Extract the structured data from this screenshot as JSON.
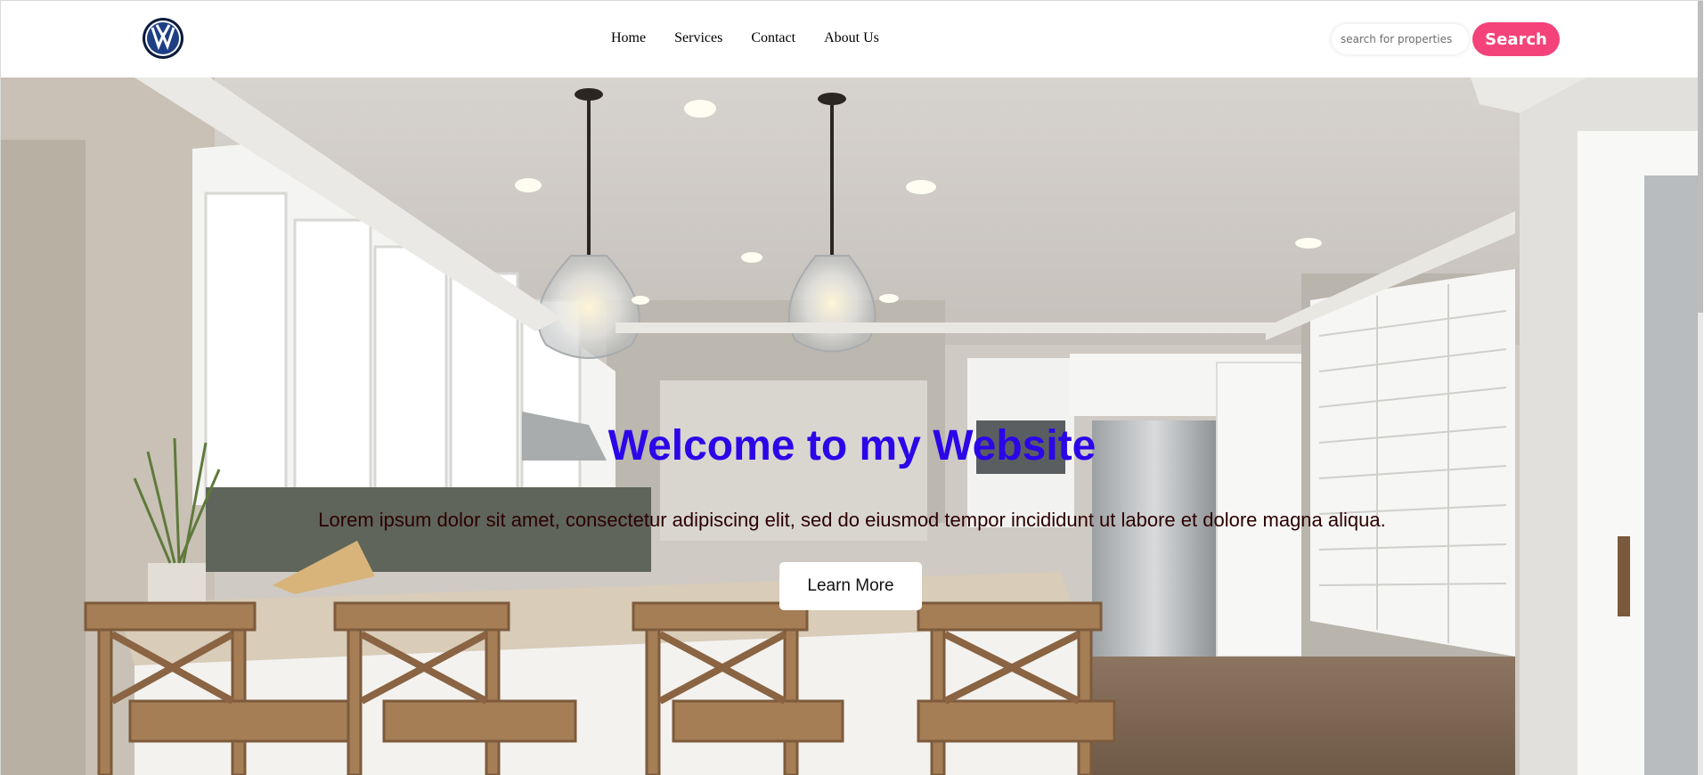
{
  "header": {
    "logo_icon": "volkswagen-logo-icon",
    "nav": [
      {
        "label": "Home"
      },
      {
        "label": "Services"
      },
      {
        "label": "Contact"
      },
      {
        "label": "About Us"
      }
    ],
    "search": {
      "placeholder": "search for properties",
      "value": "",
      "button_label": "Search"
    }
  },
  "hero": {
    "title": "Welcome to my Website",
    "subtitle": "Lorem ipsum dolor sit amet, consectetur adipiscing elit, sed do eiusmod tempor incididunt ut labore et dolore magna aliqua.",
    "button_label": "Learn More",
    "background_image": "kitchen-interior-photo"
  },
  "colors": {
    "accent": "#f4437a",
    "title": "#2b06e8",
    "subtitle": "#2b0000"
  }
}
